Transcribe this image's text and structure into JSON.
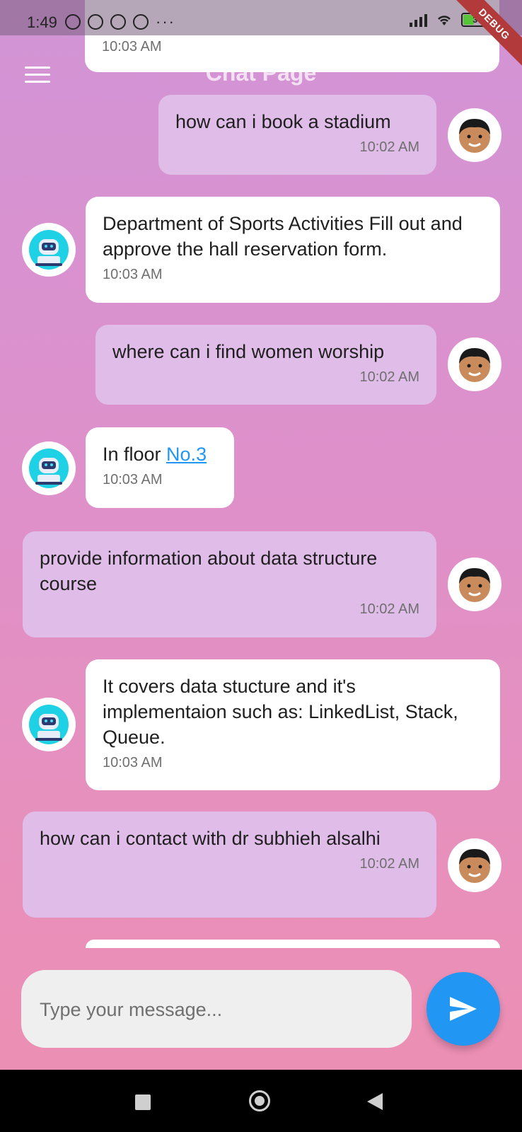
{
  "status_bar": {
    "time": "1:49",
    "battery": "36"
  },
  "debug_label": "DEBUG",
  "header": {
    "title": "Chat Page"
  },
  "top_partial": {
    "time": "10:03 AM"
  },
  "messages": [
    {
      "sender": "user",
      "text": "how can i book a stadium",
      "time": "10:02 AM"
    },
    {
      "sender": "bot",
      "text": "Department of Sports Activities Fill out and approve the hall reservation form.",
      "time": "10:03 AM"
    },
    {
      "sender": "user",
      "text": "where can i find women worship",
      "time": "10:02 AM"
    },
    {
      "sender": "bot",
      "text_prefix": "In floor ",
      "link_text": "No.3",
      "time": "10:03 AM"
    },
    {
      "sender": "user",
      "text": "provide information about data structure course",
      "time": "10:02 AM"
    },
    {
      "sender": "bot",
      "text": "It covers data stucture and it's implementaion such as: LinkedList, Stack, Queue.",
      "time": "10:03 AM"
    },
    {
      "sender": "user",
      "text": "how can i contact with dr subhieh alsalhi",
      "time": "10:02 AM"
    }
  ],
  "composer": {
    "placeholder": "Type your message..."
  },
  "colors": {
    "accent": "#2196f3",
    "user_bubble": "#e0bde8",
    "bot_bubble": "#ffffff"
  },
  "icons": {
    "menu": "hamburger-menu-icon",
    "send": "send-icon",
    "user_avatar": "boy-avatar-icon",
    "bot_avatar": "robot-avatar-icon"
  }
}
